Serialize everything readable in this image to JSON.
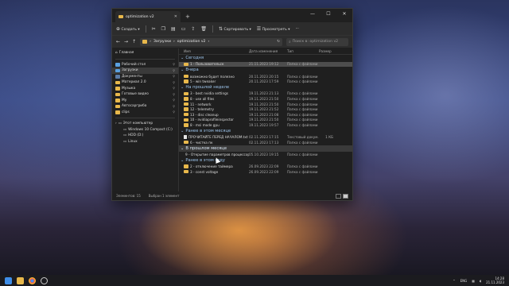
{
  "window": {
    "tab_title": "optimization v2",
    "tab_close": "✕",
    "new_tab": "+",
    "controls": {
      "minimize": "—",
      "maximize": "☐",
      "close": "✕"
    }
  },
  "toolbar": {
    "create": "Создать",
    "sort": "Сортировать",
    "view": "Просмотреть",
    "more": "···"
  },
  "address": {
    "segments": [
      "Загрузки",
      "optimization v2"
    ],
    "search_placeholder": "Поиск в: optimization v2"
  },
  "nav": {
    "home": "Главная",
    "pinned": [
      {
        "label": "Рабочий стол",
        "color": "blue"
      },
      {
        "label": "Загрузки",
        "color": "blue",
        "selected": true
      },
      {
        "label": "Документы",
        "color": "dark"
      },
      {
        "label": "Материал 2.0",
        "color": "yellow"
      },
      {
        "label": "Музыка",
        "color": "yellow"
      },
      {
        "label": "Готовые видео",
        "color": "yellow"
      },
      {
        "label": "My",
        "color": "yellow"
      },
      {
        "label": "Автосаргриба",
        "color": "yellow"
      },
      {
        "label": "clips",
        "color": "yellow"
      }
    ],
    "this_pc": "Этот компьютер",
    "drives": [
      "Windows 10 Compact (C:)",
      "HDD (D:)",
      "Linux"
    ]
  },
  "columns": {
    "name": "Имя",
    "date": "Дата изменения",
    "type": "Тип",
    "size": "Размер"
  },
  "groups": [
    {
      "title": "Сегодня",
      "rows": [
        {
          "name": "1 - Пользовательск",
          "date": "21.11.2023 19:12",
          "type": "Папка с файлами",
          "size": "",
          "selected": true
        }
      ]
    },
    {
      "title": "Вчера",
      "rows": [
        {
          "name": "возможно будет полезно",
          "date": "20.11.2023 20:15",
          "type": "Папка с файлами",
          "size": ""
        },
        {
          "name": "5 - win tweaker",
          "date": "20.11.2023 17:59",
          "type": "Папка с файлами",
          "size": ""
        }
      ]
    },
    {
      "title": "На прошлой неделе",
      "rows": [
        {
          "name": "3 - best nvidia settings",
          "date": "19.11.2023 21:13",
          "type": "Папка с файлами",
          "size": ""
        },
        {
          "name": "8 - use all files",
          "date": "19.11.2023 21:50",
          "type": "Папка с файлами",
          "size": ""
        },
        {
          "name": "11 - network",
          "date": "19.11.2023 21:50",
          "type": "Папка с файлами",
          "size": ""
        },
        {
          "name": "12 - telemetry",
          "date": "19.11.2023 21:52",
          "type": "Папка с файлами",
          "size": ""
        },
        {
          "name": "13 - disc cleanup",
          "date": "19.11.2023 21:08",
          "type": "Папка с файлами",
          "size": ""
        },
        {
          "name": "10 - nvidiaprofileinspector",
          "date": "19.11.2023 21:50",
          "type": "Папка с файлами",
          "size": ""
        },
        {
          "name": "8 - msi mode gpu",
          "date": "19.11.2023 19:57",
          "type": "Папка с файлами",
          "size": ""
        }
      ]
    },
    {
      "title": "Ранее в этом месяце",
      "rows": [
        {
          "name": "ПРОЧИТАЙТЕ ПЕРЕД НАЧАЛОМ.txt",
          "date": "02.11.2023 17:15",
          "type": "Текстовый докум...",
          "size": "1 КБ",
          "doc": true
        },
        {
          "name": "6 - чистка пк",
          "date": "02.11.2023 17:13",
          "type": "Папка с файлами",
          "size": ""
        }
      ]
    },
    {
      "title": "В прошлом месяце",
      "highlight": true,
      "rows": [
        {
          "name": "9 - Открытие параметров процессора",
          "date": "05.10.2023 19:15",
          "type": "Папка с файлами",
          "size": ""
        }
      ]
    },
    {
      "title": "Ранее в этом году",
      "rows": [
        {
          "name": "2 - отключение таймера",
          "date": "26.09.2023 22:09",
          "type": "Папка с файлами",
          "size": ""
        },
        {
          "name": "3 - const voltage",
          "date": "26.09.2023 22:09",
          "type": "Папка с файлами",
          "size": ""
        }
      ]
    }
  ],
  "status": {
    "count": "Элементов: 15",
    "selected": "Выбран 1 элемент"
  },
  "taskbar": {
    "lang": "ENG",
    "time": "14:28",
    "date": "21.11.2023"
  }
}
